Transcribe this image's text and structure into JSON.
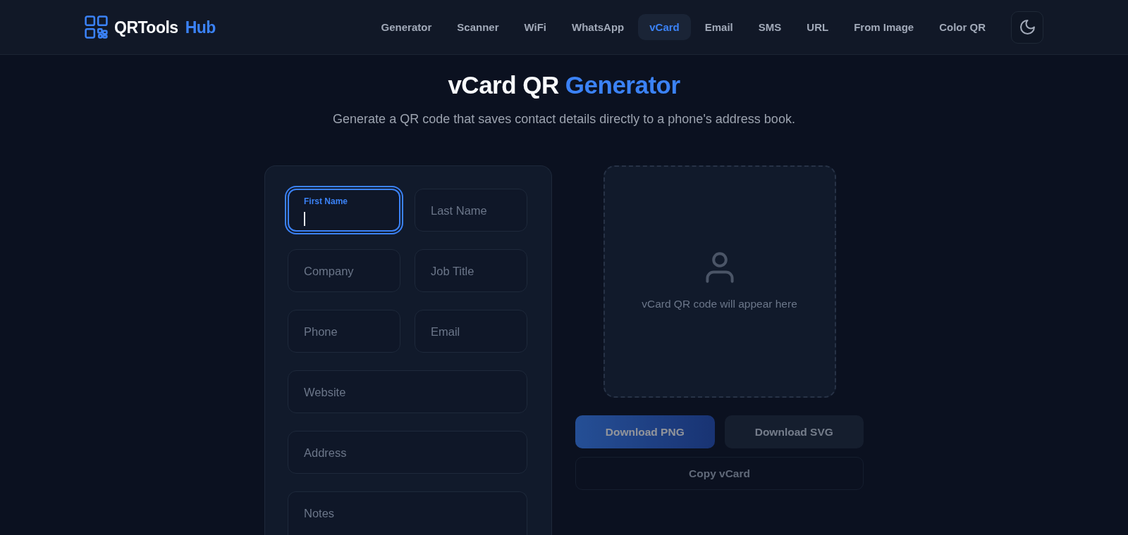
{
  "header": {
    "logo_text": "QRTools",
    "logo_accent": "Hub",
    "nav": [
      {
        "label": "Generator",
        "selected": false
      },
      {
        "label": "Scanner",
        "selected": false
      },
      {
        "label": "WiFi",
        "selected": false
      },
      {
        "label": "WhatsApp",
        "selected": false
      },
      {
        "label": "vCard",
        "selected": true
      },
      {
        "label": "Email",
        "selected": false
      },
      {
        "label": "SMS",
        "selected": false
      },
      {
        "label": "URL",
        "selected": false
      },
      {
        "label": "From Image",
        "selected": false
      },
      {
        "label": "Color QR",
        "selected": false
      }
    ]
  },
  "hero": {
    "title": "vCard QR",
    "title_accent": "Generator",
    "subtitle": "Generate a QR code that saves contact details directly to a phone's address book."
  },
  "form": {
    "rows": [
      [
        {
          "kind": "text",
          "label": "First Name",
          "focused": true
        },
        {
          "kind": "text",
          "label": "Last Name",
          "focused": false
        }
      ],
      [
        {
          "kind": "text",
          "label": "Company",
          "focused": false
        },
        {
          "kind": "text",
          "label": "Job Title",
          "focused": false
        }
      ],
      [
        {
          "kind": "text",
          "label": "Phone",
          "focused": false
        },
        {
          "kind": "text",
          "label": "Email",
          "focused": false
        }
      ],
      [
        {
          "kind": "text",
          "label": "Website",
          "focused": false
        }
      ],
      [
        {
          "kind": "text",
          "label": "Address",
          "focused": false
        }
      ],
      [
        {
          "kind": "textarea",
          "label": "Notes",
          "focused": false
        }
      ]
    ]
  },
  "preview": {
    "message": "vCard QR code will appear here"
  },
  "actions": {
    "downloads": [
      {
        "label": "Download PNG",
        "kind": "primary",
        "disabled": true
      },
      {
        "label": "Download SVG",
        "kind": "secondary",
        "disabled": true
      }
    ],
    "copy": {
      "label": "Copy vCard",
      "disabled": true
    }
  }
}
